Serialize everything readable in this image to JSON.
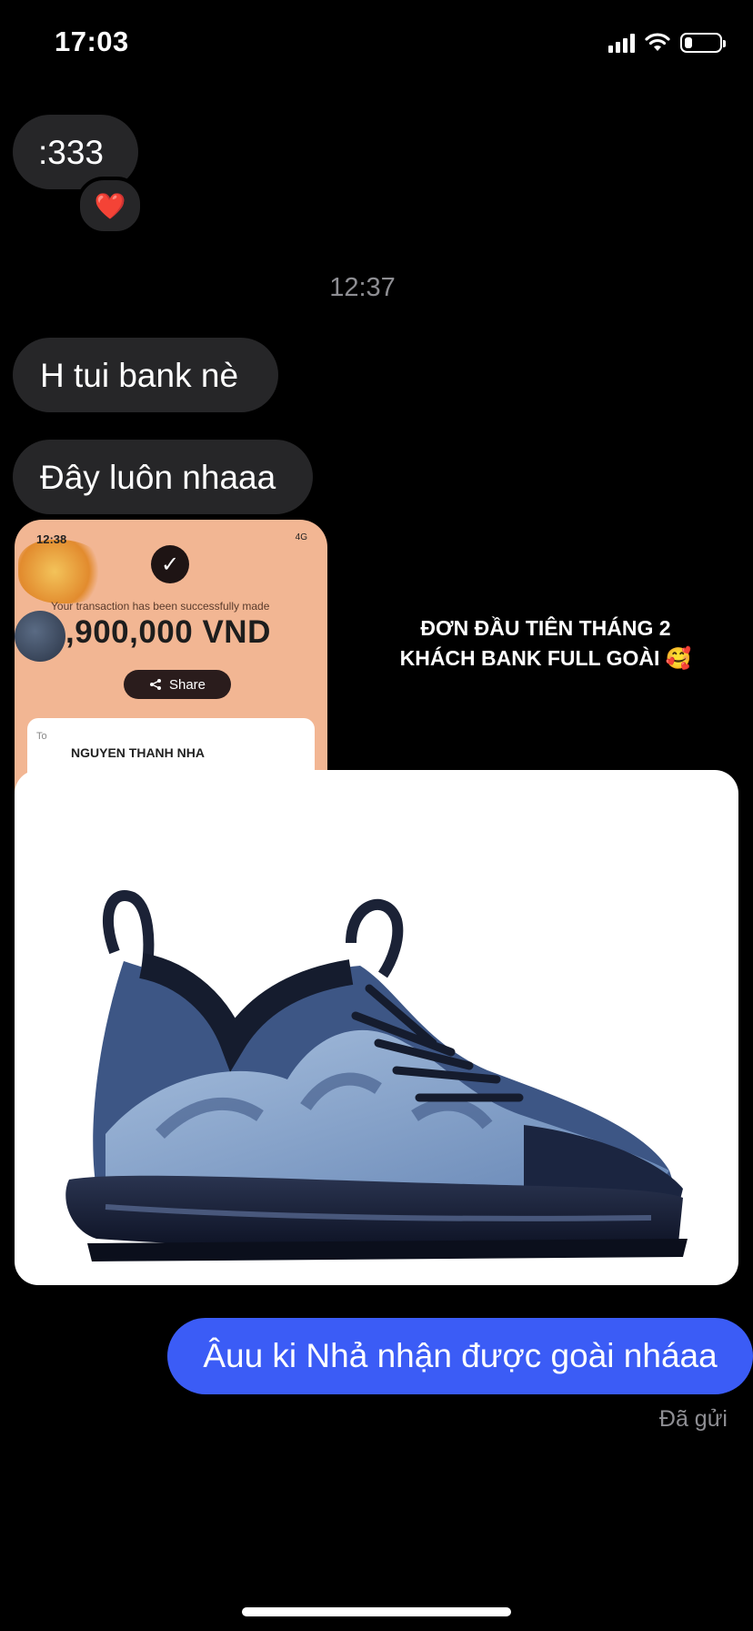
{
  "status_bar": {
    "time": "17:03"
  },
  "messages": {
    "first": ":333",
    "reaction": "❤️",
    "timestamp": "12:37",
    "second": "H tui bank nè",
    "third": "Đây luôn nhaaa",
    "reply": "Âuu ki Nhả nhận được goài nháaa",
    "sent_status": "Đã gửi"
  },
  "receipt": {
    "time": "12:38",
    "network": "4G",
    "message": "Your transaction has been successfully made",
    "amount": ",900,000 VND",
    "share_label": "Share",
    "to_label": "To",
    "recipient": "NGUYEN THANH NHA"
  },
  "caption": {
    "line1": "ĐƠN ĐẦU TIÊN THÁNG 2",
    "line2": "KHÁCH BANK FULL GOÀI 🥰"
  },
  "colors": {
    "incoming_bubble": "#262628",
    "outgoing_bubble": "#3b5cf6",
    "background": "#000000"
  }
}
